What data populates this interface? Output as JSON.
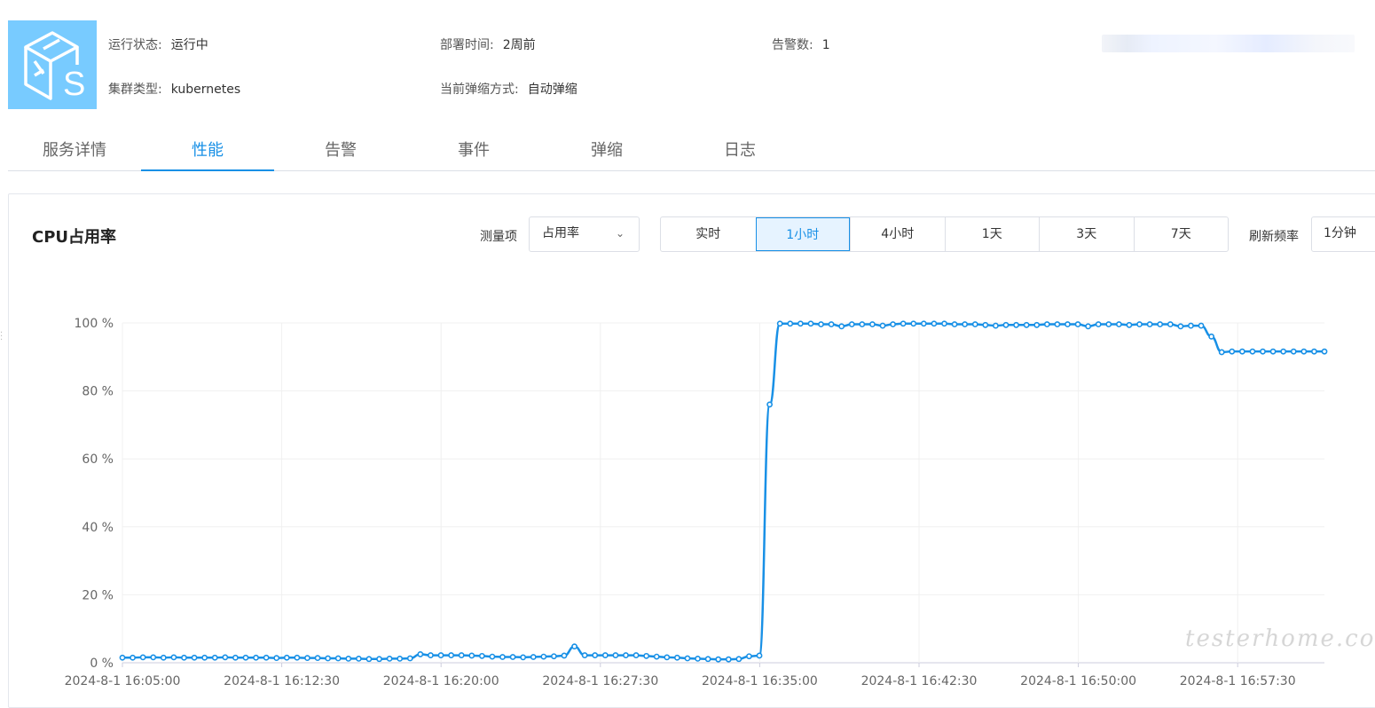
{
  "header": {
    "run_status_label": "运行状态:",
    "run_status_value": "运行中",
    "deploy_time_label": "部署时间:",
    "deploy_time_value": "2周前",
    "alert_count_label": "告警数:",
    "alert_count_value": "1",
    "cluster_type_label": "集群类型:",
    "cluster_type_value": "kubernetes",
    "scaling_label": "当前弹缩方式:",
    "scaling_value": "自动弹缩",
    "logo_icon": "service-box-icon"
  },
  "tabs": [
    {
      "label": "服务详情"
    },
    {
      "label": "性能"
    },
    {
      "label": "告警"
    },
    {
      "label": "事件"
    },
    {
      "label": "弹缩"
    },
    {
      "label": "日志"
    }
  ],
  "active_tab": "性能",
  "panel": {
    "title": "CPU占用率",
    "metric_label": "测量项",
    "metric_value": "占用率",
    "time_ranges": [
      "实时",
      "1小时",
      "4小时",
      "1天",
      "3天",
      "7天"
    ],
    "active_range": "1小时",
    "refresh_label": "刷新频率",
    "refresh_value": "1分钟"
  },
  "accent_color": "#1890e6",
  "watermark": "testerhome.com",
  "chart_data": {
    "type": "line",
    "ylim": [
      0,
      100
    ],
    "y_ticks": [
      "0 %",
      "20 %",
      "40 %",
      "60 %",
      "80 %",
      "100 %"
    ],
    "x_ticks": [
      "2024-8-1 16:05:00",
      "2024-8-1 16:12:30",
      "2024-8-1 16:20:00",
      "2024-8-1 16:27:30",
      "2024-8-1 16:35:00",
      "2024-8-1 16:42:30",
      "2024-8-1 16:50:00",
      "2024-8-1 16:57:30"
    ],
    "x_start": "2024-8-1 16:05:00",
    "x_interval_seconds": 30,
    "series": [
      {
        "color": "#1890e6",
        "values": [
          1.5,
          1.5,
          1.6,
          1.6,
          1.5,
          1.6,
          1.5,
          1.5,
          1.5,
          1.5,
          1.6,
          1.5,
          1.5,
          1.5,
          1.5,
          1.4,
          1.5,
          1.5,
          1.4,
          1.4,
          1.3,
          1.3,
          1.2,
          1.2,
          1.1,
          1.1,
          1.2,
          1.2,
          1.3,
          2.5,
          2.2,
          2.2,
          2.2,
          2.2,
          2.1,
          2.0,
          1.8,
          1.7,
          1.7,
          1.6,
          1.7,
          1.8,
          1.9,
          2.1,
          4.8,
          2.2,
          2.2,
          2.2,
          2.2,
          2.2,
          2.2,
          2.0,
          1.8,
          1.6,
          1.5,
          1.3,
          1.2,
          1.1,
          1.0,
          1.0,
          1.1,
          1.9,
          2.1,
          76,
          99.8,
          99.8,
          99.8,
          99.8,
          99.6,
          99.6,
          99.0,
          99.6,
          99.6,
          99.6,
          99.2,
          99.6,
          99.8,
          99.8,
          99.8,
          99.8,
          99.8,
          99.6,
          99.6,
          99.6,
          99.4,
          99.2,
          99.4,
          99.4,
          99.4,
          99.4,
          99.6,
          99.6,
          99.6,
          99.6,
          99.0,
          99.6,
          99.6,
          99.6,
          99.4,
          99.6,
          99.6,
          99.6,
          99.6,
          99.0,
          99.2,
          99.2,
          96.0,
          91.4,
          91.6,
          91.6,
          91.6,
          91.6,
          91.6,
          91.6,
          91.6,
          91.6,
          91.6,
          91.6
        ]
      }
    ]
  }
}
